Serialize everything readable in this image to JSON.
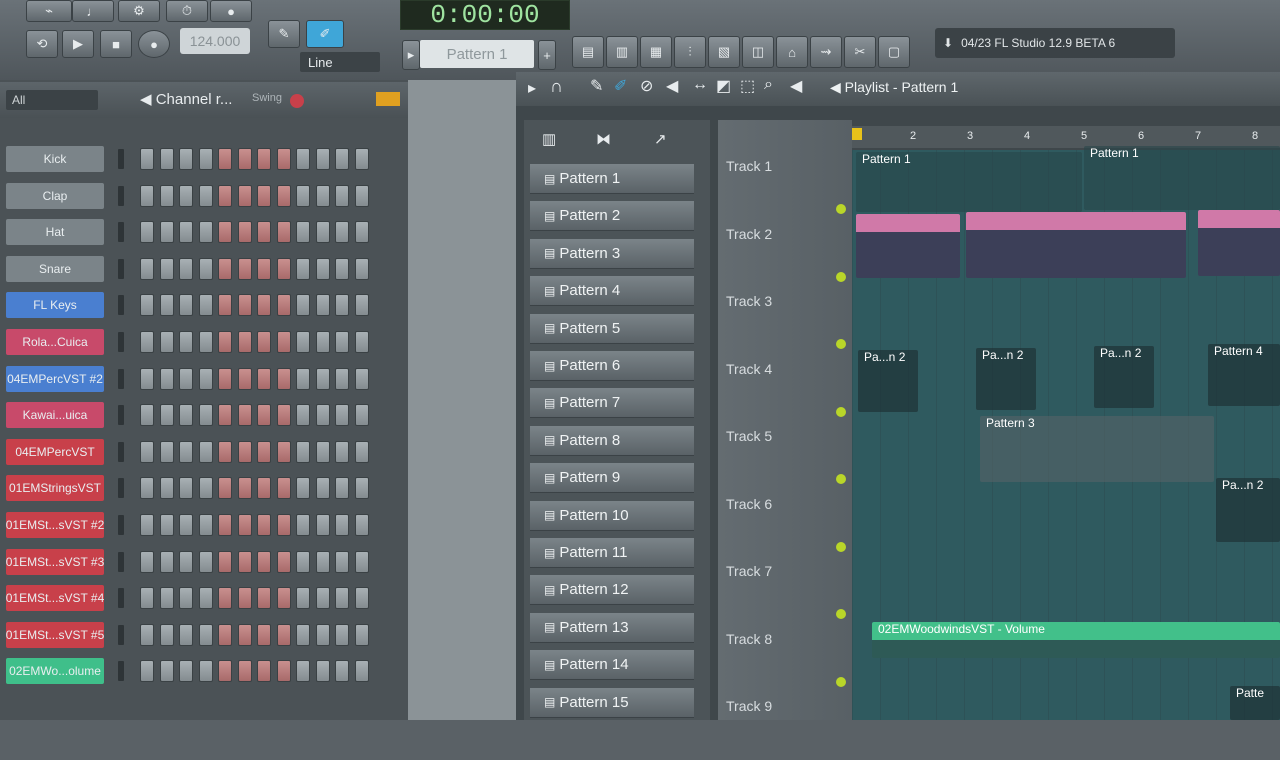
{
  "transport": {
    "time": "0:00:00",
    "bpm": "124.000",
    "snap": "Line",
    "pattern": "Pattern 1"
  },
  "hint": "04/23  FL Studio 12.9 BETA 6",
  "channel_rack": {
    "filter": "All",
    "title": "Channel r...",
    "swing_label": "Swing",
    "channels": [
      {
        "name": "Kick",
        "color": "#7b8489"
      },
      {
        "name": "Clap",
        "color": "#7b8489"
      },
      {
        "name": "Hat",
        "color": "#7b8489"
      },
      {
        "name": "Snare",
        "color": "#7b8489"
      },
      {
        "name": "FL Keys",
        "color": "#4a7fd0"
      },
      {
        "name": "Rola...Cuica",
        "color": "#c84a6a"
      },
      {
        "name": "04EMPercVST #2",
        "color": "#4a7fd0"
      },
      {
        "name": "Kawai...uica",
        "color": "#c84a6a"
      },
      {
        "name": "04EMPercVST",
        "color": "#c8404a"
      },
      {
        "name": "01EMStringsVST",
        "color": "#c8404a"
      },
      {
        "name": "01EMSt...sVST #2",
        "color": "#c8404a"
      },
      {
        "name": "01EMSt...sVST #3",
        "color": "#c8404a"
      },
      {
        "name": "01EMSt...sVST #4",
        "color": "#c8404a"
      },
      {
        "name": "01EMSt...sVST #5",
        "color": "#c8404a"
      },
      {
        "name": "02EMWo...olume",
        "color": "#3fbf8a"
      }
    ]
  },
  "playlist": {
    "title": "Playlist - Pattern 1",
    "patterns": [
      "Pattern 1",
      "Pattern 2",
      "Pattern 3",
      "Pattern 4",
      "Pattern 5",
      "Pattern 6",
      "Pattern 7",
      "Pattern 8",
      "Pattern 9",
      "Pattern 10",
      "Pattern 11",
      "Pattern 12",
      "Pattern 13",
      "Pattern 14",
      "Pattern 15"
    ],
    "tracks": [
      "Track 1",
      "Track 2",
      "Track 3",
      "Track 4",
      "Track 5",
      "Track 6",
      "Track 7",
      "Track 8",
      "Track 9"
    ],
    "bars": [
      "2",
      "3",
      "4",
      "5",
      "6",
      "7",
      "8"
    ],
    "clips": {
      "p1a": "Pattern 1",
      "p1b": "Pattern 1",
      "pa2a": "Pa...n 2",
      "pa2b": "Pa...n 2",
      "pa2c": "Pa...n 2",
      "p4": "Pattern 4",
      "p3": "Pattern 3",
      "pa2d": "Pa...n 2",
      "auto": "02EMWoodwindsVST - Volume",
      "patt": "Patte"
    }
  }
}
